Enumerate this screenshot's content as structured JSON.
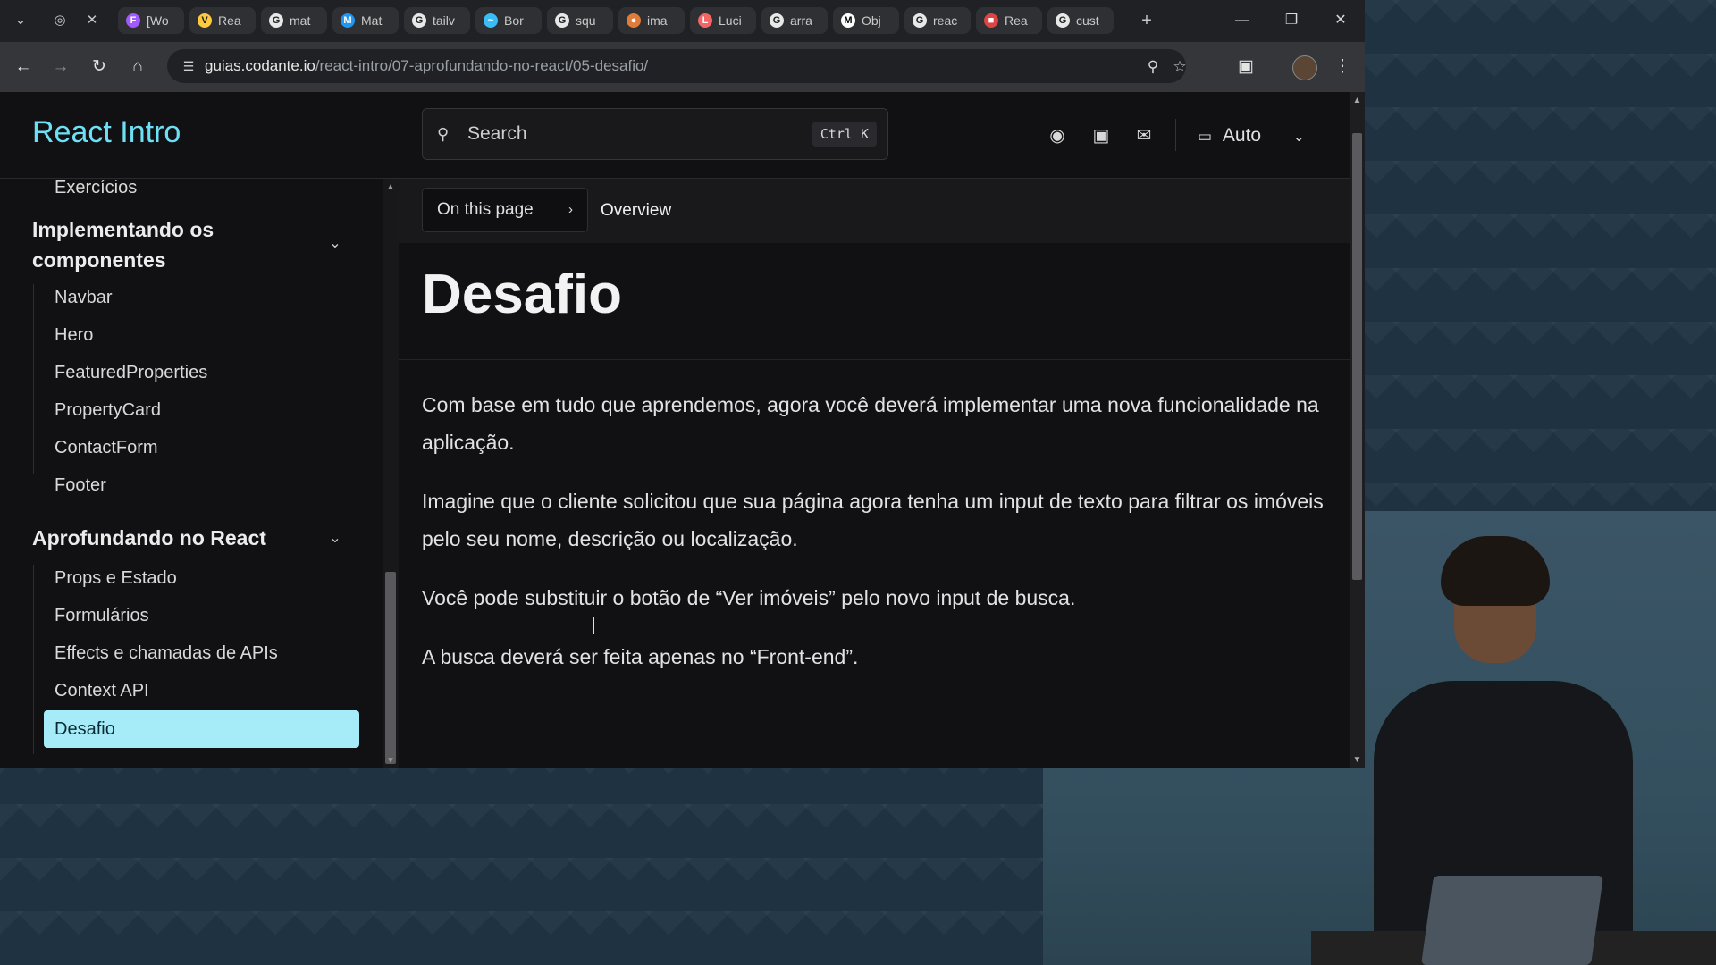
{
  "browser": {
    "tabs": [
      {
        "icon": "figma-icon",
        "title": "[Wo"
      },
      {
        "icon": "vite-icon",
        "title": "Rea"
      },
      {
        "icon": "google-icon",
        "title": "mat"
      },
      {
        "icon": "mui-icon",
        "title": "Mat"
      },
      {
        "icon": "google-icon",
        "title": "tailv"
      },
      {
        "icon": "tailwind-icon",
        "title": "Bor"
      },
      {
        "icon": "google-icon",
        "title": "squ"
      },
      {
        "icon": "image-icon",
        "title": "ima"
      },
      {
        "icon": "lucide-icon",
        "title": "Luci"
      },
      {
        "icon": "google-icon",
        "title": "arra"
      },
      {
        "icon": "mdn-icon",
        "title": "Obj"
      },
      {
        "icon": "google-icon",
        "title": "reac"
      },
      {
        "icon": "gallery-icon",
        "title": "Rea"
      },
      {
        "icon": "google-icon",
        "title": "cust"
      }
    ],
    "url_host": "guias.codante.io",
    "url_path": "/react-intro/07-aprofundando-no-react/05-desafio/"
  },
  "site": {
    "brand": "React Intro",
    "search_placeholder": "Search",
    "search_shortcut": "Ctrl K",
    "theme_label": "Auto"
  },
  "sidebar": {
    "top_item": "Exercícios",
    "group1": {
      "title": "Implementando os componentes",
      "items": [
        "Navbar",
        "Hero",
        "FeaturedProperties",
        "PropertyCard",
        "ContactForm",
        "Footer"
      ]
    },
    "group2": {
      "title": "Aprofundando no React",
      "items": [
        "Props e Estado",
        "Formulários",
        "Effects e chamadas de APIs",
        "Context API",
        "Desafio"
      ]
    }
  },
  "content": {
    "on_this_page": "On this page",
    "current_section": "Overview",
    "title": "Desafio",
    "paragraphs": [
      "Com base em tudo que aprendemos, agora você deverá implementar uma nova funcionalidade na aplicação.",
      "Imagine que o cliente solicitou que sua página agora tenha um input de texto para filtrar os imóveis pelo seu nome, descrição ou localização.",
      "Você pode substituir o botão de “Ver imóveis” pelo novo input de busca.",
      "A busca deverá ser feita apenas no “Front-end”."
    ]
  },
  "colors": {
    "brand": "#6ee0f5",
    "active_item_bg": "#a5ecf8",
    "page_bg": "#111113"
  }
}
